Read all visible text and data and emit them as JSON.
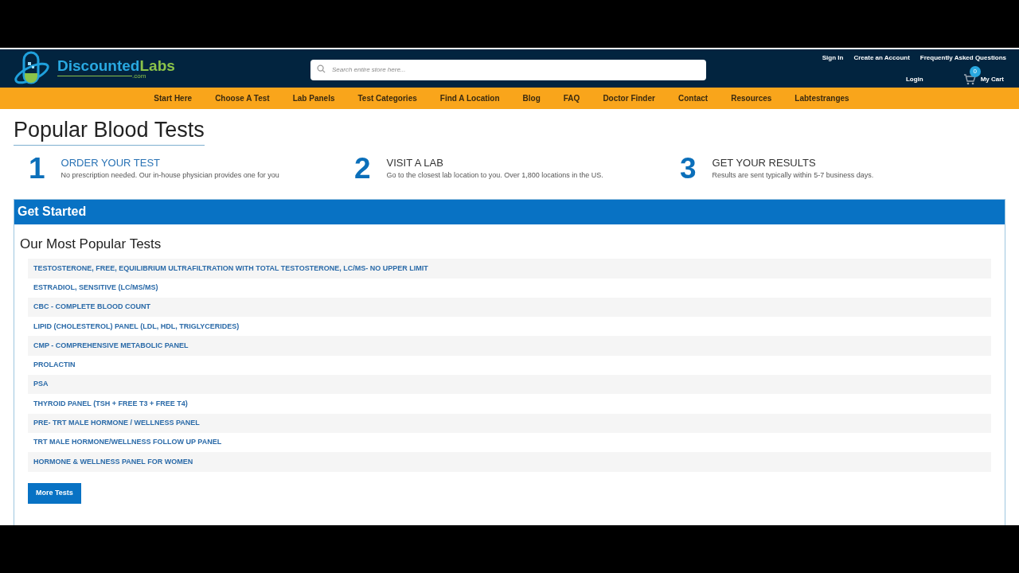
{
  "logo": {
    "name_part1": "Discounted",
    "name_part2": "Labs",
    "domain": ".com"
  },
  "search": {
    "placeholder": "Search entire store here..."
  },
  "top_links": [
    "Sign In",
    "Create an Account",
    "Frequently Asked Questions"
  ],
  "login": "Login",
  "cart": {
    "count": "0",
    "label": "My Cart"
  },
  "nav": [
    "Start Here",
    "Choose A Test",
    "Lab Panels",
    "Test Categories",
    "Find A Location",
    "Blog",
    "FAQ",
    "Doctor Finder",
    "Contact",
    "Resources",
    "Labtestranges"
  ],
  "page_title": "Popular Blood Tests",
  "steps": [
    {
      "number": "1",
      "title": "ORDER YOUR TEST",
      "text": "No prescription needed. Our in-house physician provides one for you",
      "highlighted": true
    },
    {
      "number": "2",
      "title": "VISIT A LAB",
      "text": "Go to the closest lab location to you. Over 1,800 locations in the US.",
      "highlighted": false
    },
    {
      "number": "3",
      "title": "GET YOUR RESULTS",
      "text": "Results are sent typically within 5-7 business days.",
      "highlighted": false
    }
  ],
  "panel": {
    "header": "Get Started",
    "heading": "Our Most Popular Tests",
    "tests": [
      "TESTOSTERONE, FREE, EQUILIBRIUM ULTRAFILTRATION WITH TOTAL TESTOSTERONE, LC/MS- NO UPPER LIMIT",
      "ESTRADIOL, SENSITIVE (LC/MS/MS)",
      "CBC - COMPLETE BLOOD COUNT",
      "LIPID (CHOLESTEROL) PANEL (LDL, HDL, TRIGLYCERIDES)",
      "CMP - COMPREHENSIVE METABOLIC PANEL",
      "PROLACTIN",
      "PSA",
      "THYROID PANEL (TSH + FREE T3 + FREE T4)",
      "PRE- TRT MALE HORMONE / WELLNESS PANEL",
      "TRT MALE HORMONE/WELLNESS FOLLOW UP PANEL",
      "HORMONE & WELLNESS PANEL FOR WOMEN"
    ],
    "button": "More Tests"
  }
}
